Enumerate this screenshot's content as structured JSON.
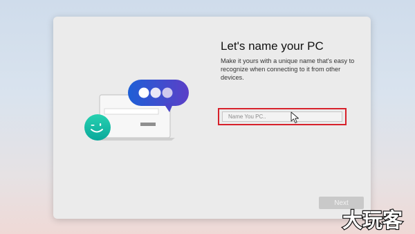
{
  "setup": {
    "title": "Let's name your PC",
    "description": "Make it yours with a unique name that's easy to recognize when connecting to it from other devices.",
    "name_input": {
      "placeholder": "Name You PC..",
      "value": ""
    },
    "next_button_label": "Next"
  },
  "illustration": {
    "icon": "laptop-with-chat-bubble-and-smiley-illustration"
  },
  "watermark": {
    "text": "大玩客"
  },
  "colors": {
    "highlight": "#d7202a",
    "bubble_blue": "#2f5fd0",
    "smiley_teal": "#17c3a8"
  }
}
